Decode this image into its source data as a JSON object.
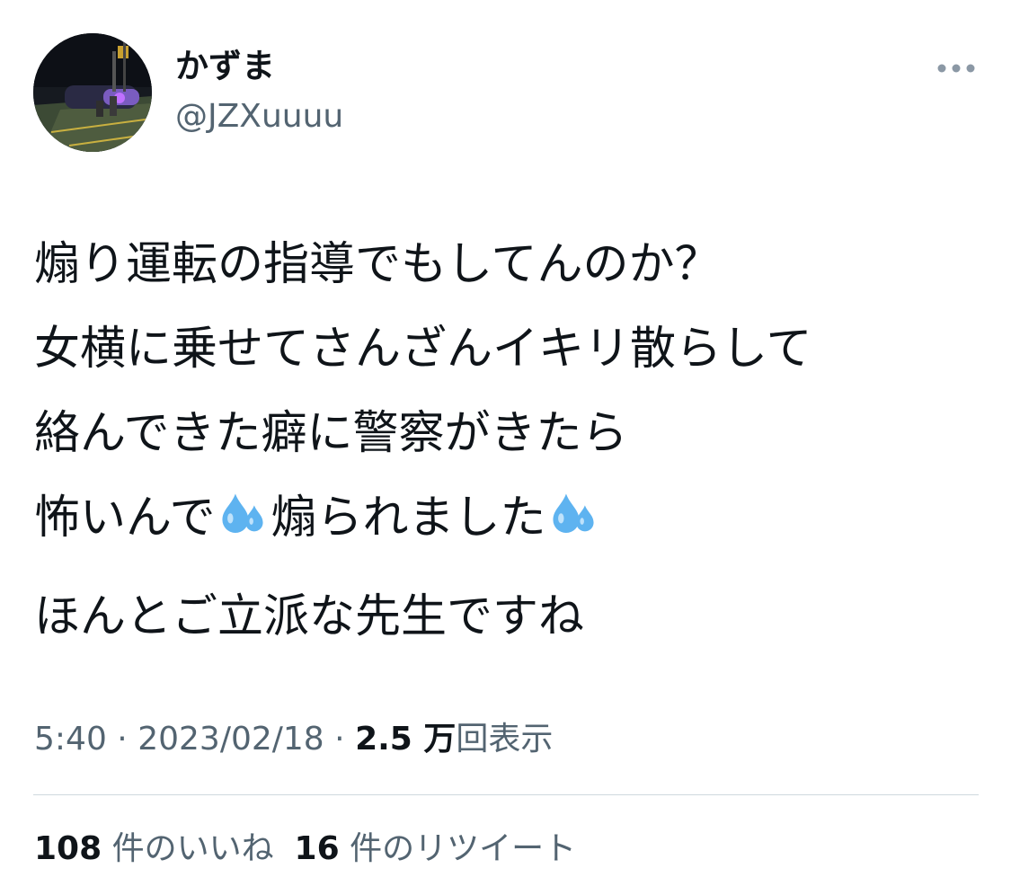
{
  "author": {
    "display_name": "かずま",
    "handle": "@JZXuuuu"
  },
  "tweet": {
    "lines": [
      "煽り運転の指導でもしてんのか？",
      "女横に乗せてさんざんイキリ散らして",
      "絡んできた癖に警察がきたら",
      "ほんとご立派な先生ですね"
    ],
    "line4_part1": "怖いんで",
    "line4_part2": "煽られました",
    "emoji_icon": "sweat-droplets-icon"
  },
  "meta": {
    "time": "5:40",
    "separator": "·",
    "date": "2023/02/18",
    "views_count": "2.5 万",
    "views_label": "回表示"
  },
  "stats": {
    "likes_count": "108",
    "likes_label": "件のいいね",
    "retweets_count": "16",
    "retweets_label": "件のリツイート"
  },
  "colors": {
    "text": "#0f1419",
    "secondary": "#536471",
    "divider": "#cfd9de",
    "emoji_blue": "#5eb3f0"
  }
}
